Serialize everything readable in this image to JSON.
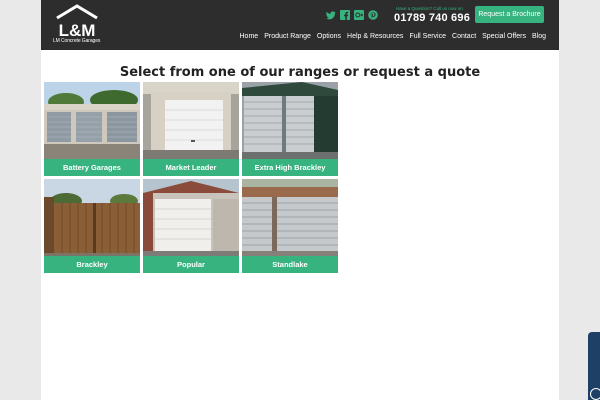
{
  "header": {
    "logo_text": "L&M",
    "logo_caption": "LM Concrete Garages",
    "question_text": "Have a Question? Call us now on",
    "phone": "01789 740 696",
    "brochure_label": "Request a Brochure",
    "social_icons": [
      "twitter-icon",
      "facebook-icon",
      "google-plus-icon",
      "pinterest-icon"
    ],
    "accent_color": "#36b37e"
  },
  "nav": {
    "items": [
      "Home",
      "Product Range",
      "Options",
      "Help & Resources",
      "Full Service",
      "Contact",
      "Special Offers",
      "Blog"
    ]
  },
  "main": {
    "heading": "Select from one of our ranges or request a quote",
    "ranges": [
      {
        "label": "Battery Garages"
      },
      {
        "label": "Market Leader"
      },
      {
        "label": "Extra High Brackley"
      },
      {
        "label": "Brackley"
      },
      {
        "label": "Popular"
      },
      {
        "label": "Standlake"
      }
    ]
  }
}
